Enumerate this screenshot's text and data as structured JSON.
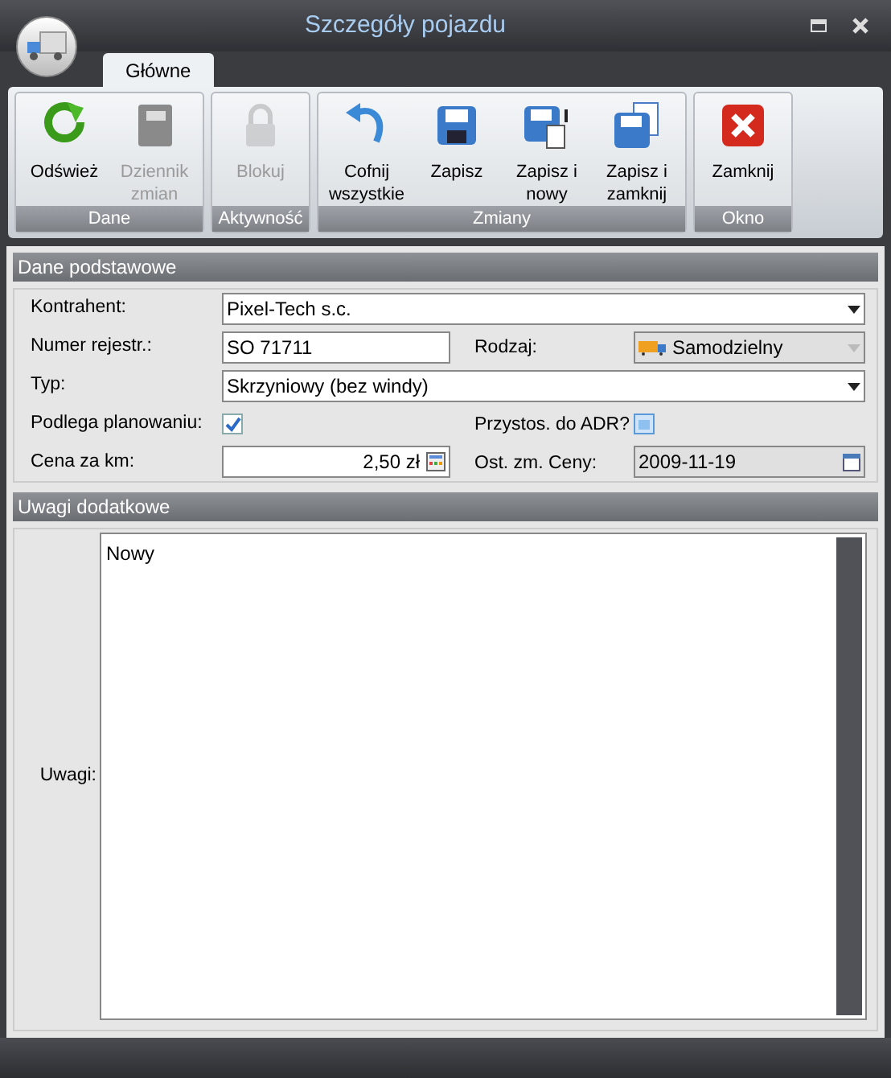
{
  "window": {
    "title": "Szczegóły pojazdu"
  },
  "tabs": [
    {
      "label": "Główne",
      "selected": true
    }
  ],
  "ribbon_groups": [
    {
      "label": "Dane",
      "buttons": [
        {
          "label": "Odśwież",
          "kind": "refresh",
          "disabled": false
        },
        {
          "label": "Dziennik zmian",
          "kind": "journal",
          "disabled": true
        }
      ]
    },
    {
      "label": "Aktywność",
      "buttons": [
        {
          "label": "Blokuj",
          "kind": "lock",
          "disabled": true
        }
      ]
    },
    {
      "label": "Zmiany",
      "buttons": [
        {
          "label": "Cofnij wszystkie",
          "kind": "undo",
          "disabled": false
        },
        {
          "label": "Zapisz",
          "kind": "save",
          "disabled": false
        },
        {
          "label": "Zapisz i nowy",
          "kind": "save_new",
          "disabled": false
        },
        {
          "label": "Zapisz i zamknij",
          "kind": "save_close",
          "disabled": false
        }
      ]
    },
    {
      "label": "Okno",
      "buttons": [
        {
          "label": "Zamknij",
          "kind": "close",
          "disabled": false
        }
      ]
    }
  ],
  "basic": {
    "title": "Dane podstawowe",
    "contractor": {
      "label": "Kontrahent:",
      "value": "Pixel-Tech s.c."
    },
    "registration": {
      "label": "Numer rejestr.:",
      "value": "SO 71711"
    },
    "kind": {
      "label": "Rodzaj:",
      "value": "Samodzielny",
      "disabled": true
    },
    "type": {
      "label": "Typ:",
      "value": "Skrzyniowy (bez windy)"
    },
    "planning": {
      "label": "Podlega planowaniu:",
      "checked": true
    },
    "adr": {
      "label": "Przystos. do ADR?",
      "checked": false
    },
    "price": {
      "label": "Cena za km:",
      "value": "2,50 zł"
    },
    "price_date": {
      "label": "Ost. zm. Ceny:",
      "value": "2009-11-19"
    }
  },
  "notes": {
    "title": "Uwagi dodatkowe",
    "label": "Uwagi:",
    "value": "Nowy"
  }
}
